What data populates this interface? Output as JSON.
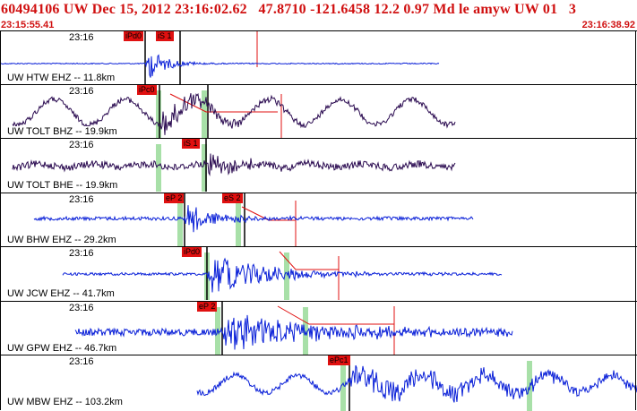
{
  "header": {
    "title": "60494106 UW Dec 15, 2012 23:16:02.62   47.8710 -121.6458 12.2 0.97 Md le amyw UW 01   3",
    "start_time": "23:15:55.41",
    "end_time": "23:16:38.92"
  },
  "panels": [
    {
      "tick": "23:16",
      "channel": "UW HTW EHZ -- 11.8km",
      "picks": [
        "iPd0",
        "iS 1"
      ],
      "color": "#0a20d8"
    },
    {
      "tick": "23:16",
      "channel": "UW TOLT BHZ -- 19.9km",
      "picks": [
        "iPc0"
      ],
      "color": "#2a0a50"
    },
    {
      "tick": "23:16",
      "channel": "UW TOLT BHE -- 19.9km",
      "picks": [
        "iS 1"
      ],
      "color": "#2a0a50"
    },
    {
      "tick": "23:16",
      "channel": "UW BHW EHZ -- 29.2km",
      "picks": [
        "eP 2",
        "eS 2"
      ],
      "color": "#0a20d8"
    },
    {
      "tick": "23:16",
      "channel": "UW JCW EHZ -- 41.7km",
      "picks": [
        "iPd0"
      ],
      "color": "#0a20d8"
    },
    {
      "tick": "23:16",
      "channel": "UW GPW EHZ -- 46.7km",
      "picks": [
        "eP 2"
      ],
      "color": "#0a20d8"
    },
    {
      "tick": "23:16",
      "channel": "UW MBW EHZ -- 103.2km",
      "picks": [
        "ePc1"
      ],
      "color": "#0a20d8"
    }
  ]
}
